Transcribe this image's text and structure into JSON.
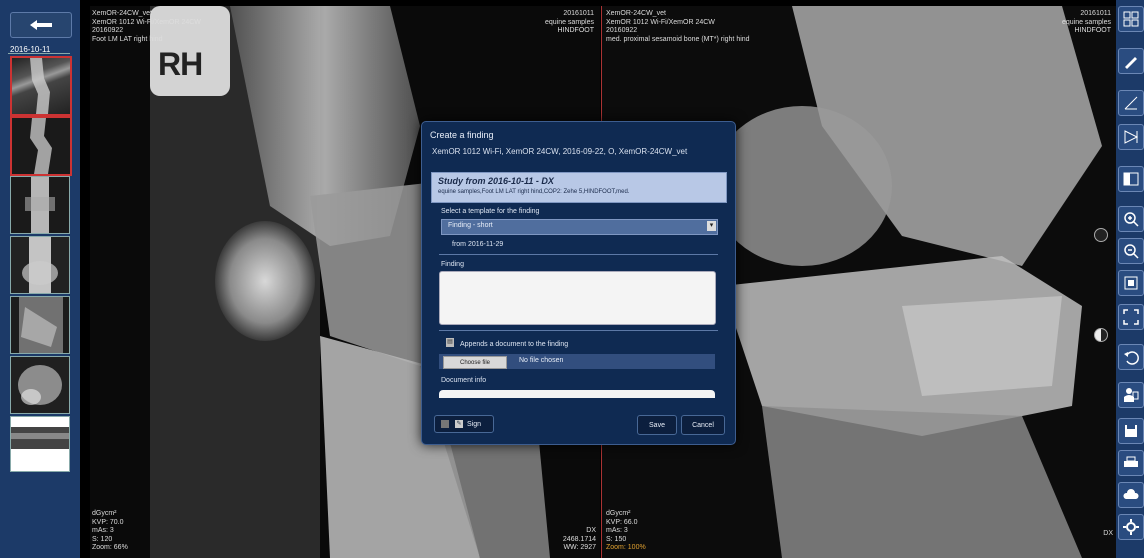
{
  "sidebar": {
    "date": "2016-10-11",
    "thumbnails": [
      "Image 1",
      "Image 2",
      "Image 3",
      "Image 4",
      "Image 5",
      "Image 6",
      "Image 7"
    ],
    "selected_thumbnails": [
      0,
      1
    ]
  },
  "logo_text": "RH",
  "viewport_left": {
    "top_left": "XemOR-24CW_vet\nXemOR 1012 Wi-Fi/XemOR 24CW\n20160922\nFoot LM LAT right hind",
    "top_right": "20161011\nequine samples\nHINDFOOT",
    "bottom_left": "dGycm²\nKVP: 70.0\nmAs: 3\nS: 120\nZoom: 66%",
    "bottom_right": "DX\n2468.1714\nWW: 2927"
  },
  "viewport_right": {
    "top_left": "XemOR-24CW_vet\nXemOR 1012 Wi-Fi/XemOR 24CW\n20160922\nmed. proximal sesamoid bone (MT*) right hind",
    "top_right": "20161011\nequine samples\nHINDFOOT",
    "bottom_left": "dGycm²\nKVP: 66.0\nmAs: 3\nS: 150",
    "bottom_left_zoom": "Zoom: 100%",
    "bottom_right": "DX"
  },
  "toolbar": {
    "icons": [
      "layout-grid-icon",
      "draw-icon",
      "measure-icon",
      "rotate-flip-icon",
      "split-view-icon",
      "zoom-in-icon",
      "zoom-out-icon",
      "fit-screen-icon",
      "fullscreen-icon",
      "undo-icon",
      "finding-icon",
      "save-disk-icon",
      "print-icon",
      "cloud-icon",
      "settings-icon"
    ]
  },
  "dialog": {
    "title": "Create a finding",
    "device_line": "XemOR 1012 Wi-Fi, XemOR 24CW, 2016-09-22, O, XemOR-24CW_vet",
    "study_title": "Study from 2016-10-11 - DX",
    "study_desc": "equine samples,Foot LM LAT right hind,COP2: Zehe 5,HINDFOOT,med.",
    "template_label": "Select a template for the finding",
    "template_value": "Finding - short",
    "template_from": "from 2016-11-29",
    "finding_label": "Finding",
    "finding_value": "",
    "attach_label": "Appends a document to the finding",
    "choose_file_label": "Choose file",
    "no_file_label": "No file chosen",
    "document_info_label": "Document info",
    "sign_label": "Sign",
    "save_label": "Save",
    "cancel_label": "Cancel"
  }
}
